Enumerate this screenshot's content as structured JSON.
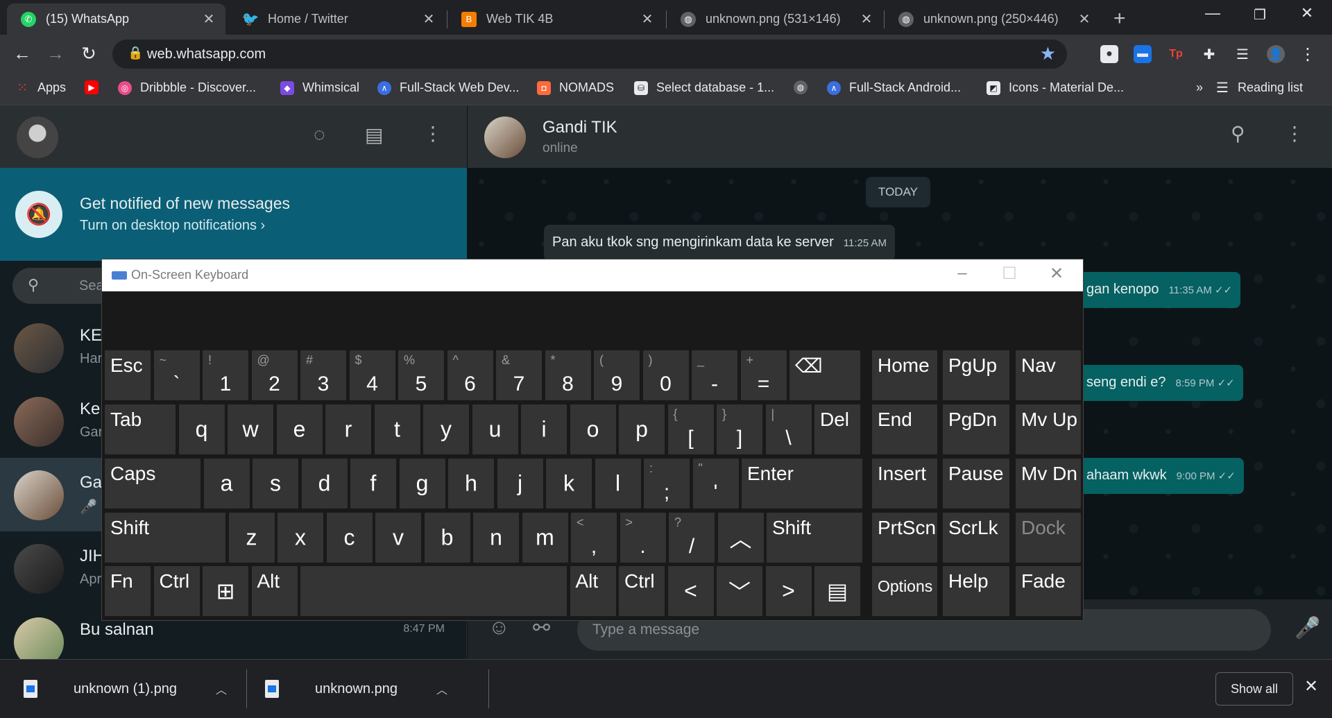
{
  "browser": {
    "tabs": [
      {
        "title": "(15) WhatsApp",
        "favicon": "whatsapp-icon",
        "active": true
      },
      {
        "title": "Home / Twitter",
        "favicon": "twitter-icon",
        "active": false
      },
      {
        "title": "Web TIK 4B",
        "favicon": "blogger-icon",
        "active": false
      },
      {
        "title": "unknown.png (531×146)",
        "favicon": "globe-icon",
        "active": false
      },
      {
        "title": "unknown.png (250×446)",
        "favicon": "globe-icon",
        "active": false
      }
    ],
    "url": "web.whatsapp.com",
    "bookmarks": [
      {
        "label": "Apps",
        "icon": "apps-grid-icon"
      },
      {
        "label": "",
        "icon": "youtube-icon"
      },
      {
        "label": "Dribbble - Discover...",
        "icon": "dribbble-icon"
      },
      {
        "label": "Whimsical",
        "icon": "whimsical-icon"
      },
      {
        "label": "Full-Stack Web Dev...",
        "icon": "site-icon"
      },
      {
        "label": "NOMADS",
        "icon": "nomads-icon"
      },
      {
        "label": "Select database - 1...",
        "icon": "database-icon"
      },
      {
        "label": "",
        "icon": "globe-icon"
      },
      {
        "label": "Full-Stack Android...",
        "icon": "site-icon"
      },
      {
        "label": "Icons - Material De...",
        "icon": "material-icon"
      }
    ],
    "bookmarks_overflow": "»",
    "reading_list": "Reading list"
  },
  "whatsapp": {
    "notification": {
      "title": "Get notified of new messages",
      "subtitle": "Turn on desktop notifications ›"
    },
    "search_placeholder": "Sea",
    "chats": [
      {
        "name": "KE",
        "preview": "Har",
        "time": ""
      },
      {
        "name": "Ke",
        "preview": "Gar",
        "time": ""
      },
      {
        "name": "Ga",
        "preview": "🎤 0",
        "time": ""
      },
      {
        "name": "JIH",
        "preview": "Apr",
        "time": ""
      },
      {
        "name": "Bu salnan",
        "preview": "",
        "time": "8:47 PM"
      }
    ],
    "contact": {
      "name": "Gandi TIK",
      "status": "online"
    },
    "day_label": "TODAY",
    "messages": [
      {
        "text": "Pan aku tkok sng mengirinkam data ke server",
        "time": "11:25 AM",
        "dir": "in"
      },
      {
        "text": "gan kenopo",
        "time": "11:35 AM ✓✓",
        "dir": "out"
      },
      {
        "text": "seng endi e?",
        "time": "8:59 PM ✓✓",
        "dir": "out"
      },
      {
        "text": "ahaam wkwk",
        "time": "9:00 PM ✓✓",
        "dir": "out"
      }
    ],
    "composer_placeholder": "Type a message"
  },
  "downloads": {
    "items": [
      {
        "name": "unknown (1).png"
      },
      {
        "name": "unknown.png"
      }
    ],
    "show_all": "Show all"
  },
  "osk": {
    "title": "On-Screen Keyboard",
    "rows": [
      [
        {
          "main": "Esc"
        },
        {
          "up": "~",
          "lo": "`"
        },
        {
          "up": "!",
          "lo": "1"
        },
        {
          "up": "@",
          "lo": "2"
        },
        {
          "up": "#",
          "lo": "3"
        },
        {
          "up": "$",
          "lo": "4"
        },
        {
          "up": "%",
          "lo": "5"
        },
        {
          "up": "^",
          "lo": "6"
        },
        {
          "up": "&",
          "lo": "7"
        },
        {
          "up": "*",
          "lo": "8"
        },
        {
          "up": "(",
          "lo": "9"
        },
        {
          "up": ")",
          "lo": "0"
        },
        {
          "up": "_",
          "lo": "-"
        },
        {
          "up": "+",
          "lo": "="
        },
        {
          "main": "⌫"
        }
      ],
      [
        {
          "main": "Tab"
        },
        {
          "ctr": "q"
        },
        {
          "ctr": "w"
        },
        {
          "ctr": "e"
        },
        {
          "ctr": "r"
        },
        {
          "ctr": "t"
        },
        {
          "ctr": "y"
        },
        {
          "ctr": "u"
        },
        {
          "ctr": "i"
        },
        {
          "ctr": "o"
        },
        {
          "ctr": "p"
        },
        {
          "up": "{",
          "lo": "["
        },
        {
          "up": "}",
          "lo": "]"
        },
        {
          "up": "|",
          "lo": "\\"
        },
        {
          "main": "Del"
        }
      ],
      [
        {
          "main": "Caps"
        },
        {
          "ctr": "a"
        },
        {
          "ctr": "s"
        },
        {
          "ctr": "d"
        },
        {
          "ctr": "f"
        },
        {
          "ctr": "g"
        },
        {
          "ctr": "h"
        },
        {
          "ctr": "j"
        },
        {
          "ctr": "k"
        },
        {
          "ctr": "l"
        },
        {
          "up": ":",
          "lo": ";"
        },
        {
          "up": "\"",
          "lo": "'"
        },
        {
          "main": "Enter"
        }
      ],
      [
        {
          "main": "Shift"
        },
        {
          "ctr": "z"
        },
        {
          "ctr": "x"
        },
        {
          "ctr": "c"
        },
        {
          "ctr": "v"
        },
        {
          "ctr": "b"
        },
        {
          "ctr": "n"
        },
        {
          "ctr": "m"
        },
        {
          "up": "<",
          "lo": ","
        },
        {
          "up": ">",
          "lo": "."
        },
        {
          "up": "?",
          "lo": "/"
        },
        {
          "ctr": "︿"
        },
        {
          "main": "Shift"
        }
      ],
      [
        {
          "main": "Fn"
        },
        {
          "main": "Ctrl"
        },
        {
          "ctr": "⊞"
        },
        {
          "main": "Alt"
        },
        {
          "main": ""
        },
        {
          "main": "Alt"
        },
        {
          "main": "Ctrl"
        },
        {
          "ctr": "<"
        },
        {
          "ctr": "﹀"
        },
        {
          "ctr": ">"
        },
        {
          "ctr": "▤"
        }
      ]
    ],
    "nav_keys": [
      [
        "Home",
        "PgUp",
        "Nav"
      ],
      [
        "End",
        "PgDn",
        "Mv Up"
      ],
      [
        "Insert",
        "Pause",
        "Mv Dn"
      ],
      [
        "PrtScn",
        "ScrLk",
        "Dock"
      ],
      [
        "Options",
        "Help",
        "Fade"
      ]
    ]
  }
}
